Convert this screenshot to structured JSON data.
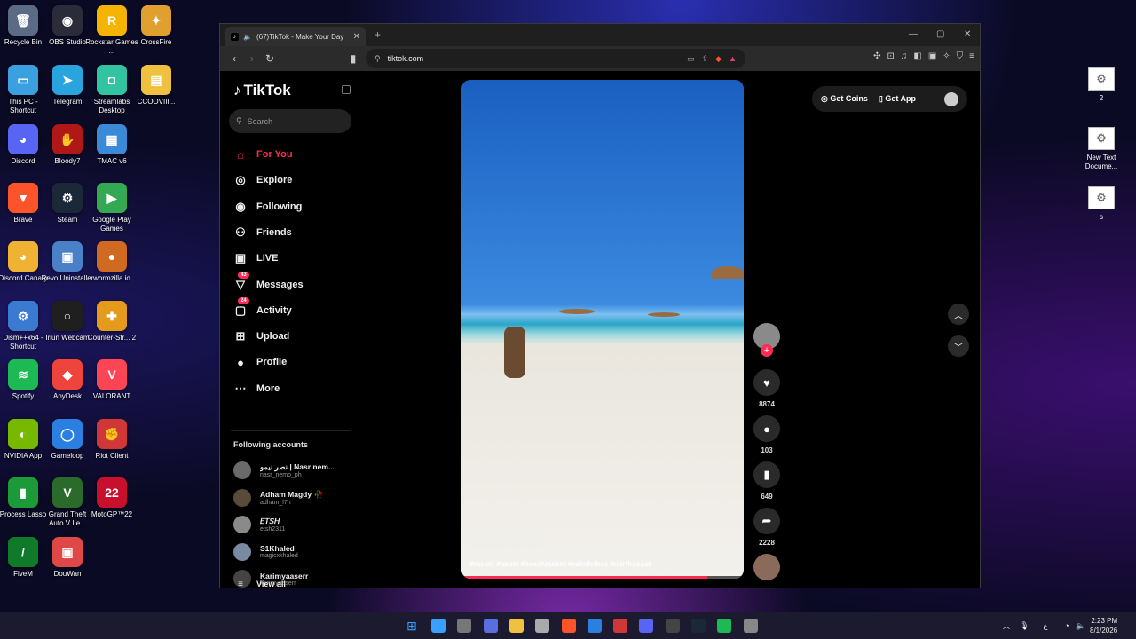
{
  "desktop": {
    "left_icons": [
      {
        "label": "Recycle Bin",
        "color": "#5b6b86",
        "glyph": "🗑"
      },
      {
        "label": "OBS Studio",
        "color": "#2b2b3a",
        "glyph": "◉"
      },
      {
        "label": "Rockstar Games ...",
        "color": "#f5b400",
        "glyph": "R"
      },
      {
        "label": "CrossFire",
        "color": "#e0a030",
        "glyph": "✦"
      },
      {
        "label": "This PC - Shortcut",
        "color": "#3aa0e0",
        "glyph": "▭"
      },
      {
        "label": "Telegram",
        "color": "#2aa4de",
        "glyph": "➤"
      },
      {
        "label": "Streamlabs Desktop",
        "color": "#31c3a2",
        "glyph": "◘"
      },
      {
        "label": "CCOOVIII...",
        "color": "#f0c040",
        "glyph": "▤"
      },
      {
        "label": "Discord",
        "color": "#5865f2",
        "glyph": "◕"
      },
      {
        "label": "Bloody7",
        "color": "#b01818",
        "glyph": "✋"
      },
      {
        "label": "TMAC v6",
        "color": "#3a8ad8",
        "glyph": "▦"
      },
      {
        "label": "Brave",
        "color": "#fb542b",
        "glyph": "▼"
      },
      {
        "label": "Steam",
        "color": "#1b2838",
        "glyph": "⚙"
      },
      {
        "label": "Google Play Games",
        "color": "#34a853",
        "glyph": "▶"
      },
      {
        "label": "Discord Canary",
        "color": "#f0b232",
        "glyph": "◕"
      },
      {
        "label": "Revo Uninstaller",
        "color": "#4a80c8",
        "glyph": "▣"
      },
      {
        "label": "wormzilla.io",
        "color": "#d06a20",
        "glyph": "●"
      },
      {
        "label": "Dism++x64 - Shortcut",
        "color": "#3a7ad0",
        "glyph": "⚙"
      },
      {
        "label": "Iriun Webcam",
        "color": "#1f1f1f",
        "glyph": "○"
      },
      {
        "label": "Counter-Str... 2",
        "color": "#e49a1a",
        "glyph": "✚"
      },
      {
        "label": "Spotify",
        "color": "#1db954",
        "glyph": "≋"
      },
      {
        "label": "AnyDesk",
        "color": "#ef443b",
        "glyph": "◆"
      },
      {
        "label": "VALORANT",
        "color": "#fd4556",
        "glyph": "V"
      },
      {
        "label": "NVIDIA App",
        "color": "#76b900",
        "glyph": "◐"
      },
      {
        "label": "Gameloop",
        "color": "#2a7fe0",
        "glyph": "◯"
      },
      {
        "label": "Riot Client",
        "color": "#d13639",
        "glyph": "✊"
      },
      {
        "label": "Process Lasso",
        "color": "#1c9a3a",
        "glyph": "▮"
      },
      {
        "label": "Grand Theft Auto V Le...",
        "color": "#2a6a2a",
        "glyph": "V"
      },
      {
        "label": "MotoGP™22",
        "color": "#c8102e",
        "glyph": "22"
      },
      {
        "label": "FiveM",
        "color": "#0f7a2a",
        "glyph": "/"
      },
      {
        "label": "DouWan",
        "color": "#e04848",
        "glyph": "▣"
      }
    ],
    "right_icons": [
      {
        "label": "2"
      },
      {
        "label": "New Text Docume..."
      },
      {
        "label": "s"
      }
    ]
  },
  "browser": {
    "tab_title": "(67)TikTok - Make Your Day",
    "url": "tiktok.com"
  },
  "tiktok": {
    "logo": "TikTok",
    "search_placeholder": "Search",
    "nav": [
      {
        "label": "For You",
        "icon": "⌂",
        "active": true,
        "badge": ""
      },
      {
        "label": "Explore",
        "icon": "◎",
        "active": false,
        "badge": ""
      },
      {
        "label": "Following",
        "icon": "◉",
        "active": false,
        "badge": ""
      },
      {
        "label": "Friends",
        "icon": "⚇",
        "active": false,
        "badge": ""
      },
      {
        "label": "LIVE",
        "icon": "▣",
        "active": false,
        "badge": ""
      },
      {
        "label": "Messages",
        "icon": "▽",
        "active": false,
        "badge": "43"
      },
      {
        "label": "Activity",
        "icon": "▢",
        "active": false,
        "badge": "24"
      },
      {
        "label": "Upload",
        "icon": "⊞",
        "active": false,
        "badge": ""
      },
      {
        "label": "Profile",
        "icon": "●",
        "active": false,
        "badge": ""
      },
      {
        "label": "More",
        "icon": "⋯",
        "active": false,
        "badge": ""
      }
    ],
    "following_title": "Following accounts",
    "accounts": [
      {
        "name": "نصر نيمو | Nasr nem...",
        "handle": "nasr_nemo_ph"
      },
      {
        "name": "Adham Magdy 🥀",
        "handle": "adham_l7n"
      },
      {
        "name": "𝘌𝘛𝘚𝘏",
        "handle": "etsh2311"
      },
      {
        "name": "S1Khaled",
        "handle": "magicxkhaled"
      },
      {
        "name": "Karimyaaserr",
        "handle": "karimyaaserr"
      }
    ],
    "view_all": "View all",
    "video": {
      "author": "Ibrahim Abo-Ali",
      "tags": "#racket #sahel #beachracket #sahelvibes #northcoast",
      "progress": 0.87
    },
    "actions": {
      "likes": "8874",
      "comments": "103",
      "saves": "649",
      "shares": "2228"
    },
    "get_coins": "Get Coins",
    "get_app": "Get App"
  },
  "taskbar": {
    "time": "2:23 PM",
    "date": "8/1/2026",
    "apps": [
      {
        "color": "#3aa0ff"
      },
      {
        "color": "#777"
      },
      {
        "color": "#5a6ee0"
      },
      {
        "color": "#f0c040"
      },
      {
        "color": "#aaa"
      },
      {
        "color": "#fb542b"
      },
      {
        "color": "#2a7fe0"
      },
      {
        "color": "#d13639"
      },
      {
        "color": "#5865f2"
      },
      {
        "color": "#444"
      },
      {
        "color": "#1b2838"
      },
      {
        "color": "#1db954"
      },
      {
        "color": "#888"
      }
    ]
  }
}
